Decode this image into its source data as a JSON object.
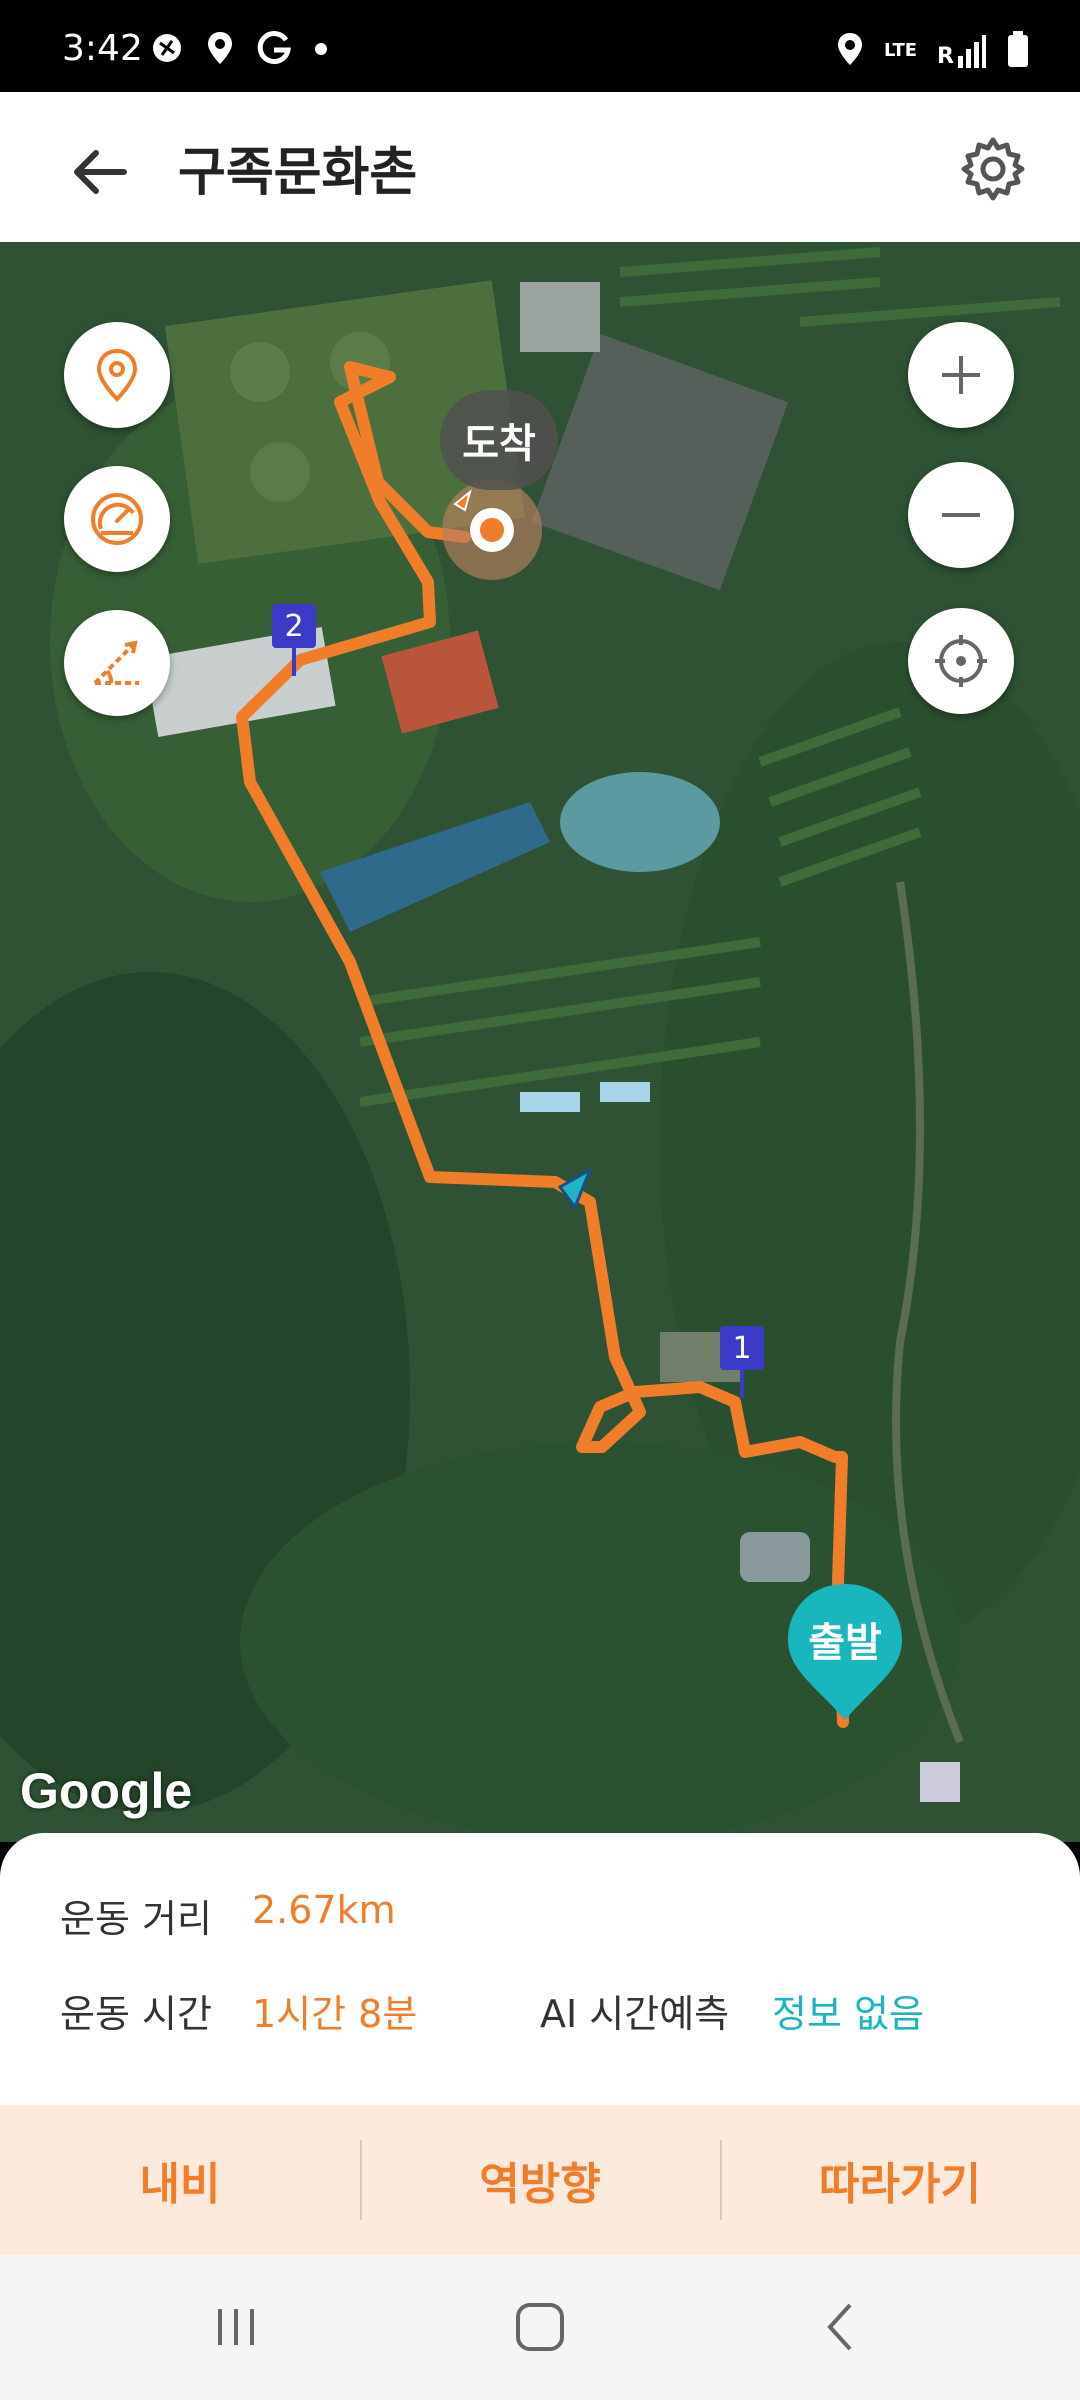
{
  "status_bar": {
    "time": "3:42",
    "network": "LTE",
    "network_sub": "R",
    "icons_left": [
      "soccer-ball-icon",
      "location-icon",
      "g-icon",
      "dot-icon"
    ],
    "icons_right": [
      "location-icon",
      "signal-icon",
      "battery-icon"
    ]
  },
  "header": {
    "title": "구족문화촌",
    "back_icon": "arrow-left-icon",
    "settings_icon": "gear-icon"
  },
  "map": {
    "arrival_label": "도착",
    "departure_label": "출발",
    "waypoint_1": "1",
    "waypoint_2": "2",
    "attribution": "Google",
    "route_color": "#f07d2a",
    "start_marker_color": "#19b6bd",
    "left_controls": [
      "location-pin-icon",
      "speedometer-icon",
      "slope-icon"
    ],
    "right_controls": [
      "zoom-in-icon",
      "zoom-out-icon",
      "crosshair-icon"
    ]
  },
  "stats": {
    "distance_label": "운동 거리",
    "distance_value": "2.67km",
    "time_label": "운동 시간",
    "time_value": "1시간 8분",
    "ai_label": "AI 시간예측",
    "ai_value": "정보 없음"
  },
  "actions": {
    "navigate": "내비",
    "reverse": "역방향",
    "follow": "따라가기"
  },
  "colors": {
    "accent": "#f07d2a",
    "teal": "#19b6bd",
    "action_bg": "#fdeadd"
  }
}
